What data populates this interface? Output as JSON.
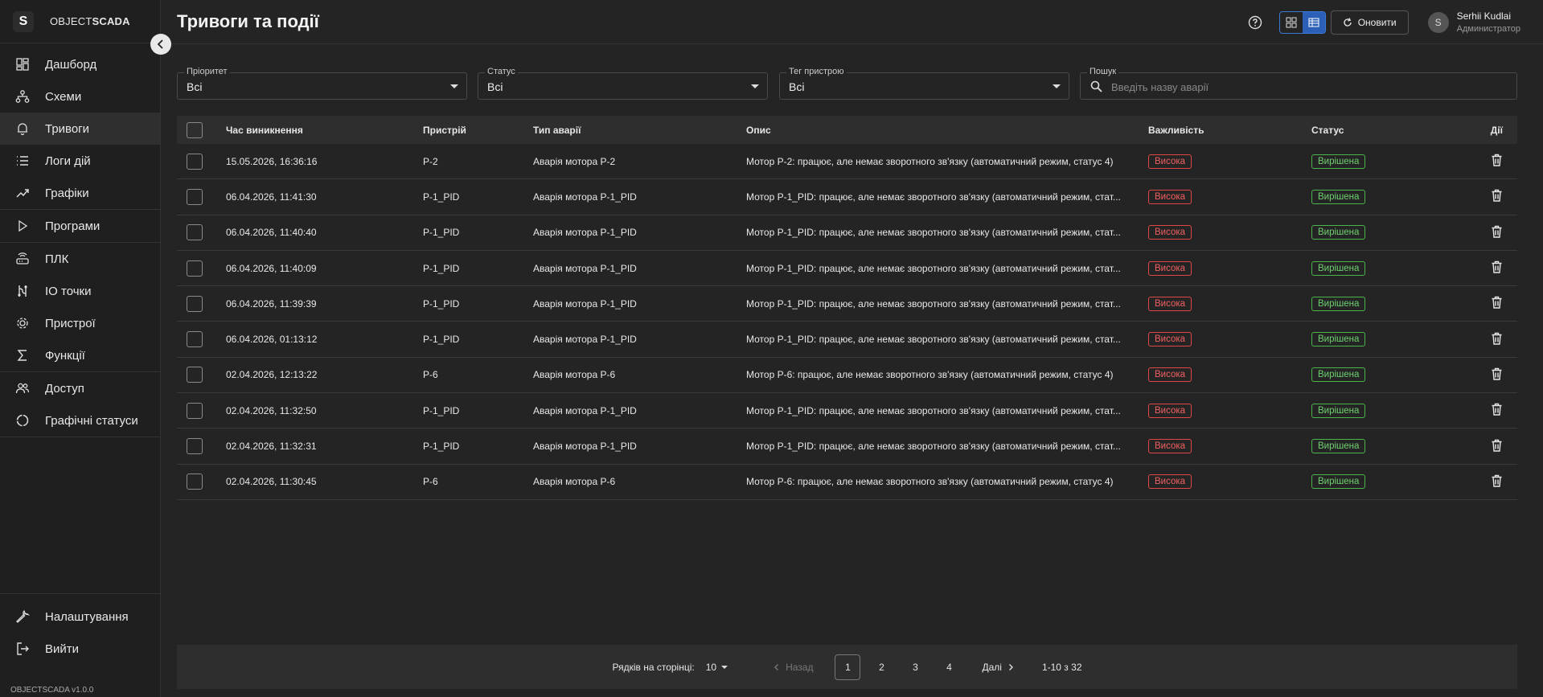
{
  "brand": {
    "mark": "S",
    "name_light": "OBJECT",
    "name_bold": "SCADA",
    "version": "OBJECTSCADA v1.0.0"
  },
  "sidebar": {
    "groups": [
      [
        {
          "label": "Дашборд",
          "icon": "dashboard-icon"
        },
        {
          "label": "Схеми",
          "icon": "schema-icon"
        },
        {
          "label": "Тривоги",
          "icon": "bell-icon",
          "active": true
        },
        {
          "label": "Логи дій",
          "icon": "list-icon"
        },
        {
          "label": "Графіки",
          "icon": "trend-icon"
        }
      ],
      [
        {
          "label": "Програми",
          "icon": "play-icon"
        }
      ],
      [
        {
          "label": "ПЛК",
          "icon": "router-icon"
        },
        {
          "label": "IO точки",
          "icon": "io-icon"
        },
        {
          "label": "Пристрої",
          "icon": "gear-icon"
        },
        {
          "label": "Функції",
          "icon": "sigma-icon"
        }
      ],
      [
        {
          "label": "Доступ",
          "icon": "users-icon"
        },
        {
          "label": "Графічні статуси",
          "icon": "circle-icon"
        }
      ]
    ],
    "bottom": [
      {
        "label": "Налаштування",
        "icon": "wrench-icon"
      },
      {
        "label": "Вийти",
        "icon": "logout-icon"
      }
    ]
  },
  "header": {
    "title": "Тривоги та події",
    "refresh_label": "Оновити",
    "user_initial": "S",
    "user_name": "Serhii Kudlai",
    "user_role": "Администратор"
  },
  "filters": {
    "priority": {
      "label": "Пріоритет",
      "value": "Всі"
    },
    "status": {
      "label": "Статус",
      "value": "Всі"
    },
    "device_tag": {
      "label": "Тег пристрою",
      "value": "Всі"
    },
    "search": {
      "label": "Пошук",
      "placeholder": "Введіть назву аварії"
    }
  },
  "table": {
    "columns": [
      "Час виникнення",
      "Пристрій",
      "Тип аварії",
      "Опис",
      "Важливість",
      "Статус",
      "Дії"
    ],
    "rows": [
      {
        "time": "15.05.2026, 16:36:16",
        "device": "P-2",
        "type": "Аварія мотора P-2",
        "desc": "Мотор P-2: працює, але немає зворотного зв'язку (автоматичний режим, статус 4)",
        "severity": "Висока",
        "status": "Вирішена"
      },
      {
        "time": "06.04.2026, 11:41:30",
        "device": "P-1_PID",
        "type": "Аварія мотора P-1_PID",
        "desc": "Мотор P-1_PID: працює, але немає зворотного зв'язку (автоматичний режим, стат...",
        "severity": "Висока",
        "status": "Вирішена"
      },
      {
        "time": "06.04.2026, 11:40:40",
        "device": "P-1_PID",
        "type": "Аварія мотора P-1_PID",
        "desc": "Мотор P-1_PID: працює, але немає зворотного зв'язку (автоматичний режим, стат...",
        "severity": "Висока",
        "status": "Вирішена"
      },
      {
        "time": "06.04.2026, 11:40:09",
        "device": "P-1_PID",
        "type": "Аварія мотора P-1_PID",
        "desc": "Мотор P-1_PID: працює, але немає зворотного зв'язку (автоматичний режим, стат...",
        "severity": "Висока",
        "status": "Вирішена"
      },
      {
        "time": "06.04.2026, 11:39:39",
        "device": "P-1_PID",
        "type": "Аварія мотора P-1_PID",
        "desc": "Мотор P-1_PID: працює, але немає зворотного зв'язку (автоматичний режим, стат...",
        "severity": "Висока",
        "status": "Вирішена"
      },
      {
        "time": "06.04.2026, 01:13:12",
        "device": "P-1_PID",
        "type": "Аварія мотора P-1_PID",
        "desc": "Мотор P-1_PID: працює, але немає зворотного зв'язку (автоматичний режим, стат...",
        "severity": "Висока",
        "status": "Вирішена"
      },
      {
        "time": "02.04.2026, 12:13:22",
        "device": "P-6",
        "type": "Аварія мотора P-6",
        "desc": "Мотор P-6: працює, але немає зворотного зв'язку (автоматичний режим, статус 4)",
        "severity": "Висока",
        "status": "Вирішена"
      },
      {
        "time": "02.04.2026, 11:32:50",
        "device": "P-1_PID",
        "type": "Аварія мотора P-1_PID",
        "desc": "Мотор P-1_PID: працює, але немає зворотного зв'язку (автоматичний режим, стат...",
        "severity": "Висока",
        "status": "Вирішена"
      },
      {
        "time": "02.04.2026, 11:32:31",
        "device": "P-1_PID",
        "type": "Аварія мотора P-1_PID",
        "desc": "Мотор P-1_PID: працює, але немає зворотного зв'язку (автоматичний режим, стат...",
        "severity": "Висока",
        "status": "Вирішена"
      },
      {
        "time": "02.04.2026, 11:30:45",
        "device": "P-6",
        "type": "Аварія мотора P-6",
        "desc": "Мотор P-6: працює, але немає зворотного зв'язку (автоматичний режим, статус 4)",
        "severity": "Висока",
        "status": "Вирішена"
      }
    ]
  },
  "pagination": {
    "rows_per_page_label": "Рядків на сторінці:",
    "rows_per_page": "10",
    "prev_label": "Назад",
    "next_label": "Далі",
    "pages": [
      "1",
      "2",
      "3",
      "4"
    ],
    "current_page": "1",
    "range": "1-10 з 32"
  },
  "colors": {
    "severity_high": "#f06060",
    "status_resolved": "#6fd06f",
    "accent": "#2b5fb8"
  }
}
